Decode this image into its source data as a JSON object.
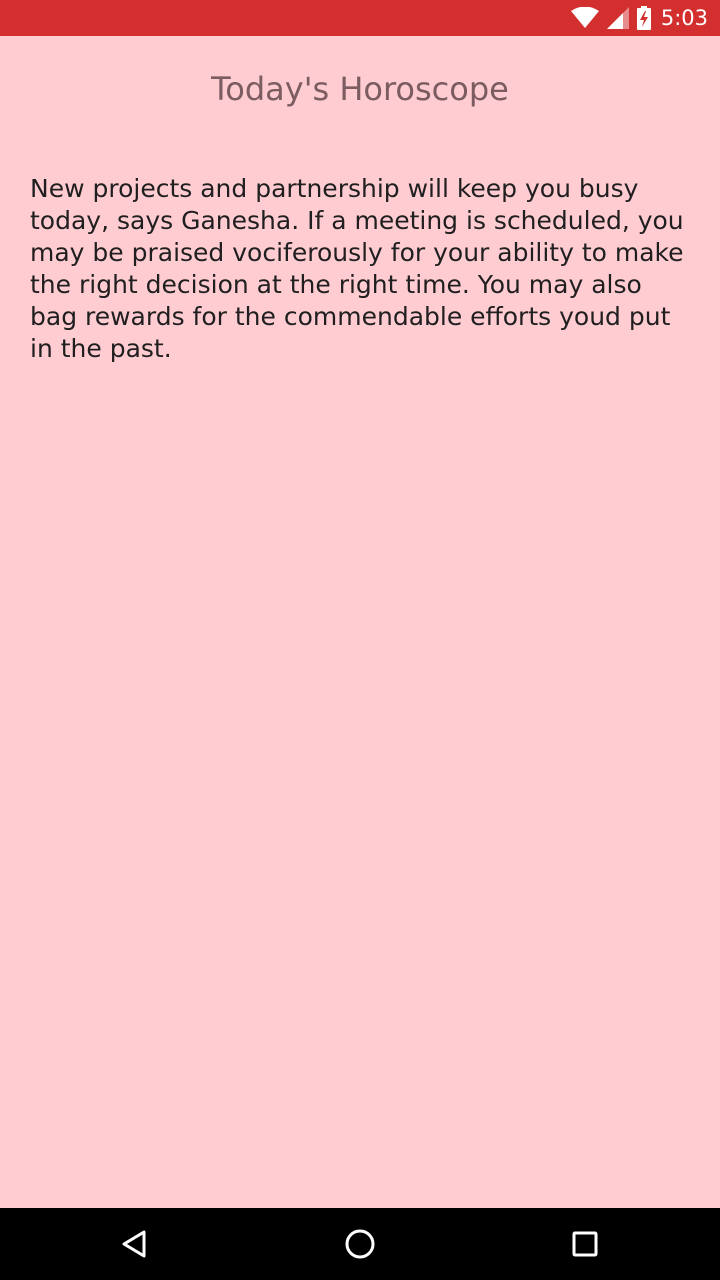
{
  "status_bar": {
    "time": "5:03",
    "icons": [
      "wifi-icon",
      "cell-signal-icon",
      "battery-charging-icon"
    ],
    "color": "#d32f2f"
  },
  "screen": {
    "title": "Today's Horoscope",
    "horoscope_text": "New projects and partnership will keep you busy today, says Ganesha. If a meeting is scheduled, you may be praised vociferously for your ability to make the right decision at the right time. You may also bag rewards for the commendable efforts youd put in the past.",
    "background_color": "#ffccd2"
  },
  "nav_bar": {
    "buttons": [
      "back-icon",
      "home-icon",
      "recents-icon"
    ]
  }
}
